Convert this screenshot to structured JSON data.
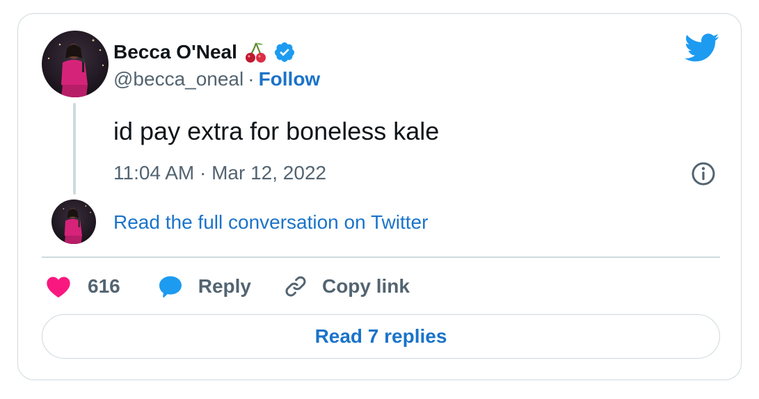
{
  "author": {
    "display_name": "Becca O'Neal",
    "handle": "@becca_oneal",
    "separator": "·",
    "follow_label": "Follow",
    "name_emoji": "cherries-emoji",
    "verified_icon": "verified-badge-icon"
  },
  "tweet": {
    "text": "id pay extra for boneless kale",
    "timestamp": "11:04 AM · Mar 12, 2022"
  },
  "conversation_link": "Read the full conversation on Twitter",
  "actions": {
    "like_count": "616",
    "reply_label": "Reply",
    "copy_link_label": "Copy link"
  },
  "read_replies_label": "Read 7 replies",
  "icons": {
    "brand": "twitter-bird-icon",
    "info": "info-icon",
    "like": "heart-icon",
    "reply": "speech-bubble-icon",
    "copy": "link-icon"
  },
  "colors": {
    "twitter_blue": "#1d9bf0",
    "link_blue": "#1a73c9",
    "heart_pink": "#f91880",
    "secondary_text": "#536471",
    "border": "#cfd9de"
  }
}
